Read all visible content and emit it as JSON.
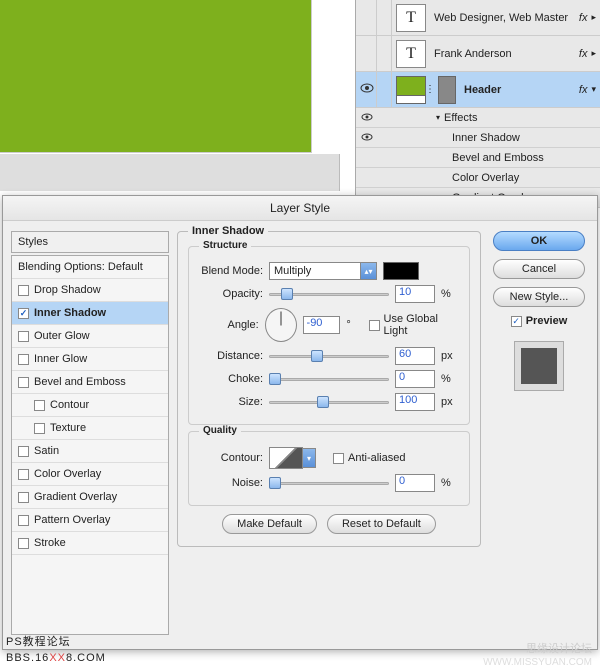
{
  "layers_panel": {
    "rows": [
      {
        "name": "Web Designer, Web Master",
        "fx": "fx",
        "type": "text"
      },
      {
        "name": "Frank Anderson",
        "fx": "fx",
        "type": "text"
      },
      {
        "name": "Header",
        "fx": "fx",
        "type": "header",
        "selected": true
      }
    ],
    "effects_label": "Effects",
    "effects": [
      "Inner Shadow",
      "Bevel and Emboss",
      "Color Overlay",
      "Gradient Overlay"
    ]
  },
  "dialog": {
    "title": "Layer Style",
    "styles_header": "Styles",
    "blending_label": "Blending Options: Default",
    "styles": [
      {
        "label": "Drop Shadow",
        "checked": false
      },
      {
        "label": "Inner Shadow",
        "checked": true,
        "active": true
      },
      {
        "label": "Outer Glow",
        "checked": false
      },
      {
        "label": "Inner Glow",
        "checked": false
      },
      {
        "label": "Bevel and Emboss",
        "checked": false
      },
      {
        "label": "Contour",
        "checked": false,
        "indent": true
      },
      {
        "label": "Texture",
        "checked": false,
        "indent": true
      },
      {
        "label": "Satin",
        "checked": false
      },
      {
        "label": "Color Overlay",
        "checked": false
      },
      {
        "label": "Gradient Overlay",
        "checked": false
      },
      {
        "label": "Pattern Overlay",
        "checked": false
      },
      {
        "label": "Stroke",
        "checked": false
      }
    ],
    "section_title": "Inner Shadow",
    "structure_label": "Structure",
    "blend_mode_label": "Blend Mode:",
    "blend_mode_value": "Multiply",
    "opacity_label": "Opacity:",
    "opacity_value": "10",
    "opacity_unit": "%",
    "angle_label": "Angle:",
    "angle_value": "-90",
    "angle_unit": "°",
    "global_light_label": "Use Global Light",
    "distance_label": "Distance:",
    "distance_value": "60",
    "distance_unit": "px",
    "choke_label": "Choke:",
    "choke_value": "0",
    "choke_unit": "%",
    "size_label": "Size:",
    "size_value": "100",
    "size_unit": "px",
    "quality_label": "Quality",
    "contour_label": "Contour:",
    "antialiased_label": "Anti-aliased",
    "noise_label": "Noise:",
    "noise_value": "0",
    "noise_unit": "%",
    "make_default": "Make Default",
    "reset_default": "Reset to Default",
    "ok": "OK",
    "cancel": "Cancel",
    "new_style": "New Style...",
    "preview_label": "Preview"
  },
  "watermark": {
    "left1": "PS教程论坛",
    "left2_a": "BBS.16",
    "left2_b": "XX",
    "left2_c": "8.COM",
    "cn": "思缘设计论坛",
    "url": "WWW.MISSYUAN.COM"
  }
}
